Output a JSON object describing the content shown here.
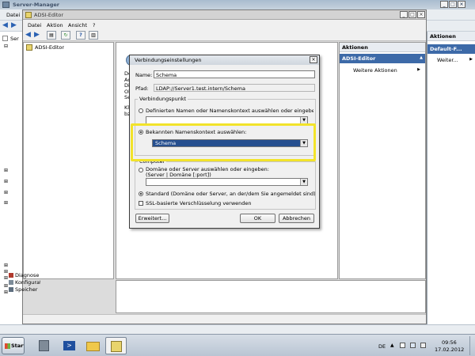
{
  "server_manager": {
    "title": "Server-Manager",
    "menu": [
      "Datei",
      "Aktion",
      "Ansicht",
      "?"
    ],
    "tree_top": "Ser",
    "tree_bottom": [
      {
        "label": "Diagnose"
      },
      {
        "label": "Konfiguration"
      },
      {
        "label": "Speicher"
      }
    ],
    "actions_header": "Aktionen",
    "actions_sub": "Default-F...",
    "actions_more": "Weiter..."
  },
  "adsi": {
    "title": "ADSI-Editor",
    "menu": [
      "Datei",
      "Aktion",
      "Ansicht",
      "?"
    ],
    "tree_root": "ADSI-Editor",
    "center_partial": [
      "De",
      "Ac",
      "Di",
      "Ol",
      "Se",
      "",
      "Kl",
      "bz"
    ],
    "actions_header": "Aktionen",
    "actions_sub": "ADSI-Editor",
    "actions_more": "Weitere Aktionen"
  },
  "dialog": {
    "title": "Verbindungseinstellungen",
    "name_label": "Name:",
    "name_value": "Schema",
    "path_label": "Pfad:",
    "path_value": "LDAP://Server1.test.intern/Schema",
    "group_connection": "Verbindungspunkt",
    "radio_custom_label": "Definierten Namen oder Namenskontext auswählen oder eingeben:",
    "custom_value": "",
    "radio_known_label": "Bekannten Namenskontext auswählen:",
    "known_value": "Schema",
    "group_computer": "Computer",
    "radio_domain_label": "Domäne oder Server auswählen oder eingeben:",
    "domain_hint": "(Server | Domäne [:port])",
    "domain_value": "",
    "radio_default_label": "Standard (Domäne oder Server, an der/dem Sie angemeldet sind)",
    "ssl_label": "SSL-basierte Verschlüsselung verwenden",
    "btn_advanced": "Erweitert...",
    "btn_ok": "OK",
    "btn_cancel": "Abbrechen"
  },
  "taskbar": {
    "start_label": "Start",
    "lang": "DE",
    "time": "09:56",
    "date": "17.02.2012"
  }
}
